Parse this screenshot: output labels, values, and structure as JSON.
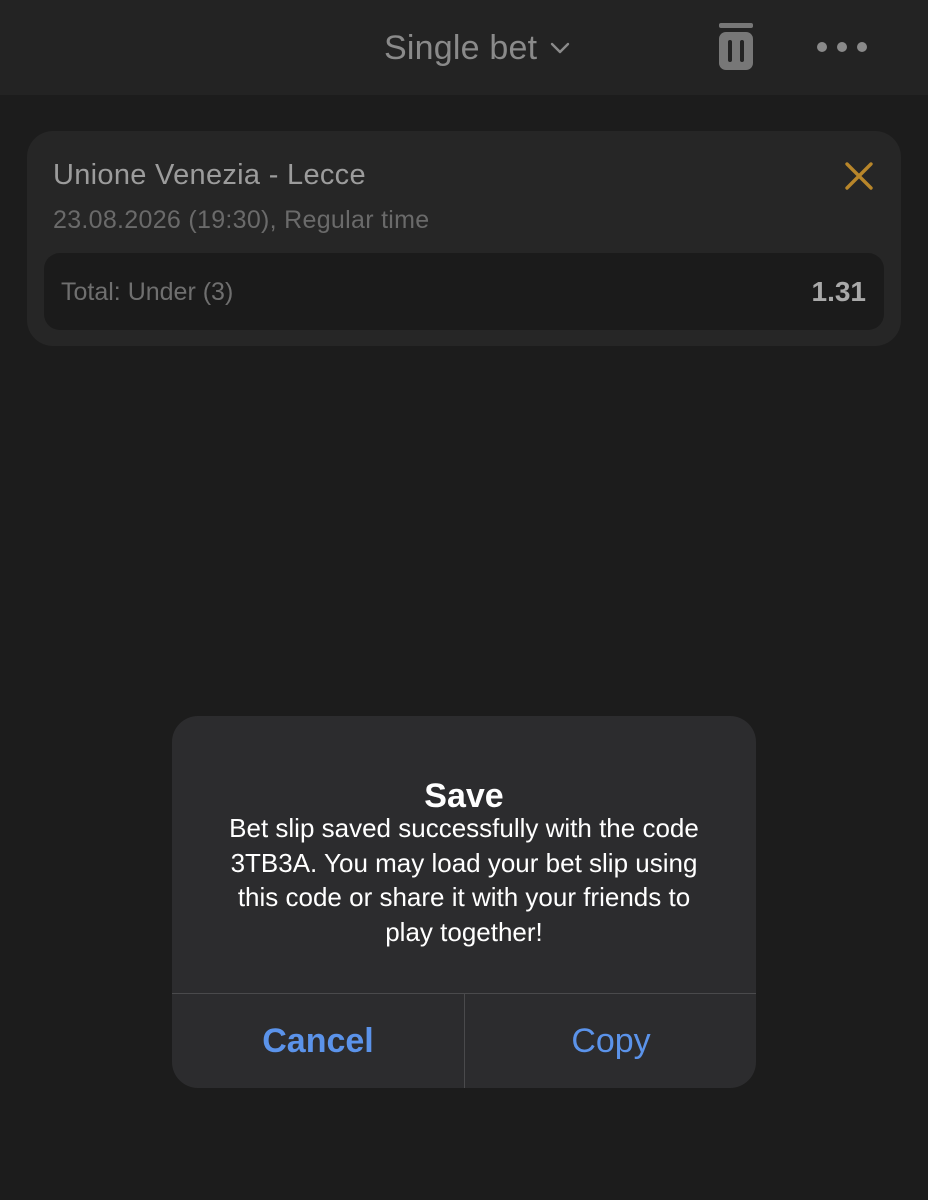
{
  "header": {
    "title": "Single bet",
    "icons": {
      "dropdown": "chevron-down-icon",
      "delete": "trash-icon",
      "menu": "more-icon"
    }
  },
  "bet_card": {
    "match": "Unione Venezia - Lecce",
    "datetime": "23.08.2026 (19:30), Regular time",
    "outcome_label": "Total: Under (3)",
    "odds": "1.31",
    "close_icon": "close-icon"
  },
  "alert": {
    "title": "Save",
    "message": "Bet slip saved successfully with the code 3TB3A. You may load your bet slip using this code or share it with your friends to play together!",
    "cancel_label": "Cancel",
    "copy_label": "Copy"
  },
  "colors": {
    "background": "#1c1c1c",
    "header_bg": "#232323",
    "card_bg": "#262626",
    "outcome_bg": "#1b1b1b",
    "alert_bg": "#2c2c2e",
    "accent_close": "#b8862a",
    "alert_button": "#5b93ea"
  }
}
